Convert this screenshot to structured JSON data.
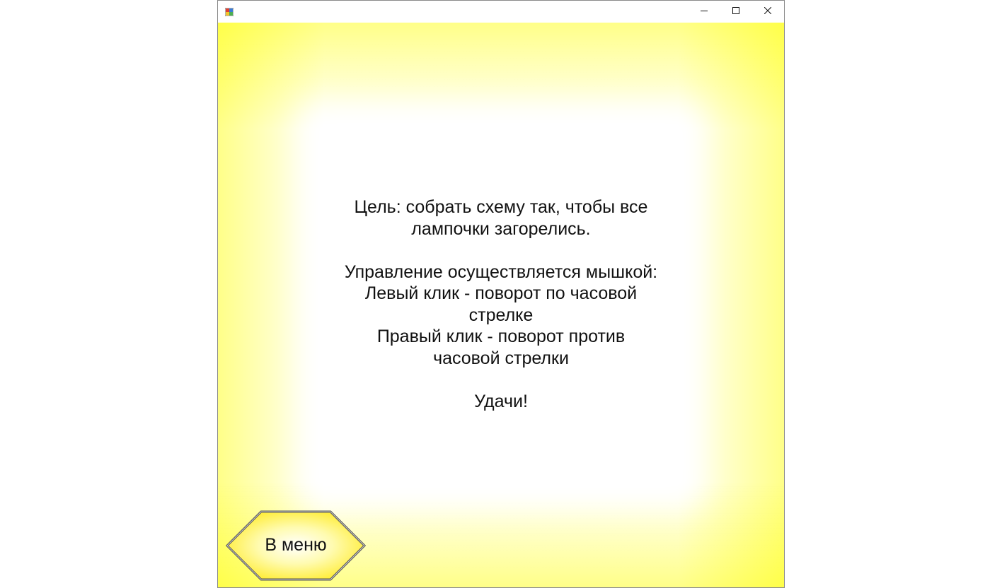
{
  "window": {
    "title": "",
    "controls": {
      "minimize_icon": "minimize-icon",
      "maximize_icon": "maximize-icon",
      "close_icon": "close-icon"
    }
  },
  "instructions": {
    "goal_line1": "Цель: собрать схему так, чтобы все",
    "goal_line2": "лампочки загорелись.",
    "control_heading": "Управление осуществляется мышкой:",
    "left_click_line1": "Левый клик - поворот по часовой",
    "left_click_line2": "стрелке",
    "right_click_line1": "Правый клик - поворот против",
    "right_click_line2": "часовой стрелки",
    "good_luck": "Удачи!"
  },
  "menu_button": {
    "label": "В меню"
  },
  "colors": {
    "background_yellow": "#ffff88",
    "panel_white": "#ffffff",
    "button_yellow": "#ffee33",
    "button_border": "#555555"
  }
}
